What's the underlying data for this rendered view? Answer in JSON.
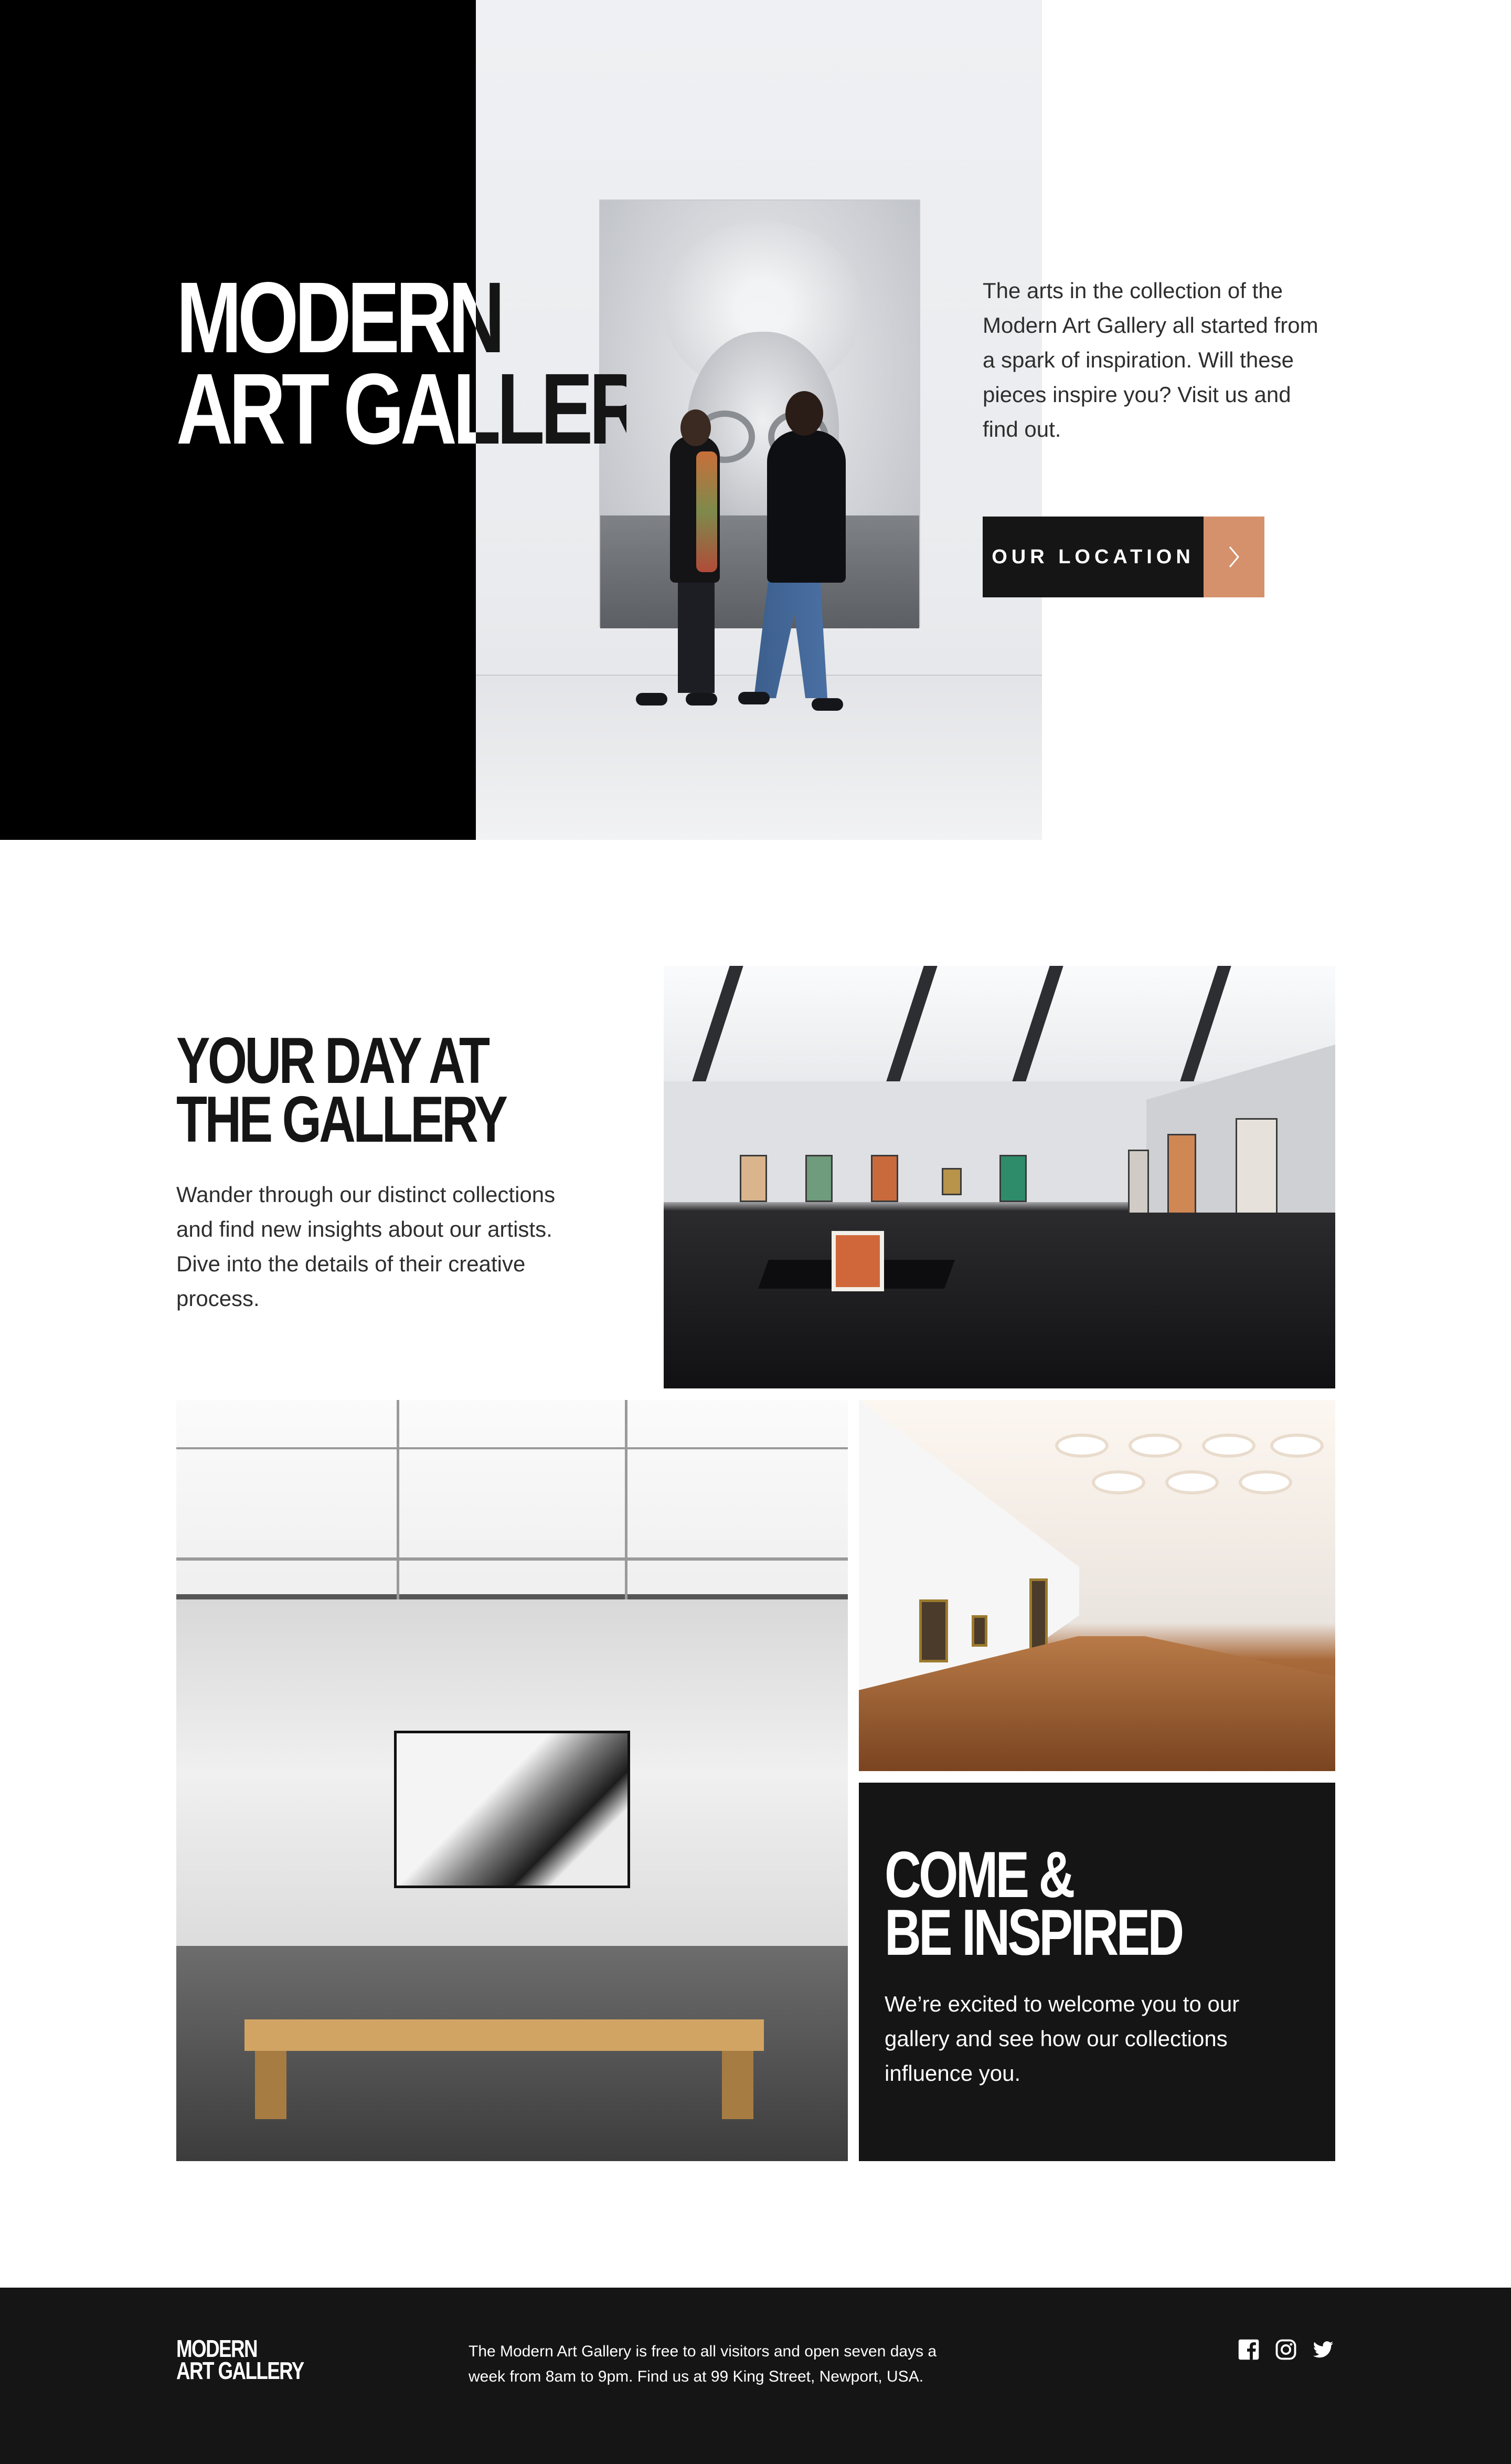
{
  "hero": {
    "title_line1": "MODERN",
    "title_line2": "ART GALLERY",
    "description": "The arts in the collection of the Modern Art Gallery all started from a spark of inspiration. Will these pieces inspire you? Visit us and find out.",
    "cta_label": "OUR LOCATION",
    "cta_icon": "chevron-right-icon"
  },
  "day": {
    "title_line1": "YOUR DAY AT",
    "title_line2": "THE GALLERY",
    "description": "Wander through our distinct collections and find new insights about our artists. Dive into the details of their creative process."
  },
  "inspire": {
    "title_line1": "COME &",
    "title_line2": "BE INSPIRED",
    "description": "We’re excited to welcome you to our gallery and see how our collections influence you."
  },
  "footer": {
    "logo_line1": "MODERN",
    "logo_line2": "ART GALLERY",
    "info": "The Modern Art Gallery is free to all visitors and open seven days a week from 8am to 9pm. Find us at 99 King Street, Newport, USA.",
    "social": [
      "facebook-icon",
      "instagram-icon",
      "twitter-icon"
    ]
  },
  "colors": {
    "accent": "#d5916b",
    "dark": "#151515",
    "black": "#000000",
    "white": "#ffffff"
  }
}
